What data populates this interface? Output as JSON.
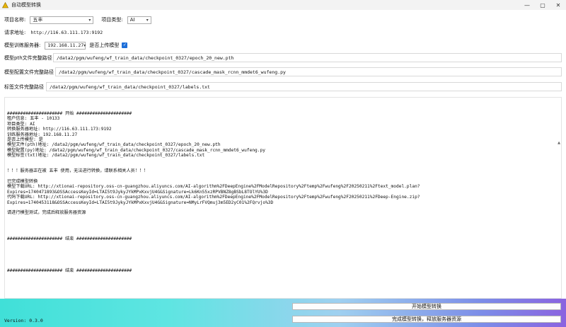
{
  "window": {
    "title": "自动模型转换",
    "minimize": "—",
    "maximize": "▢",
    "close": "✕"
  },
  "form": {
    "project_name_label": "项目名称:",
    "project_name_value": "五丰",
    "project_type_label": "项目类型:",
    "project_type_value": "AI",
    "request_url_label": "请求地址:",
    "request_url_value": "http://116.63.111.173:9192",
    "train_server_label": "模型训练服务器:",
    "train_server_value": "192.168.11.27",
    "upload_label": "是否上传模型",
    "upload_checked": true,
    "pth_label": "模型pth文件完整路径",
    "pth_value": "/data2/pgm/wufeng/wf_train_data/checkpoint_0327/epoch_20_new.pth",
    "py_label": "模型配置文件完整路径",
    "py_value": "/data2/pgm/wufeng/wf_train_data/checkpoint_0327/cascade_mask_rcnn_mmdet6_wufeng.py",
    "labels_label": "标签文件完整路径",
    "labels_value": "/data2/pgm/wufeng/wf_train_data/checkpoint_0327/labels.txt"
  },
  "log": {
    "lines": [
      "##################### 开始 #####################",
      "租户信息: 五丰 - 10133",
      "项目类型: AI",
      "转换服务器地址: http://116.63.111.173:9192",
      "训练服务器地址: 192.168.11.27",
      "是否上传模型: 是",
      "模型文件(pth)地址: /data2/pgm/wufeng/wf_train_data/checkpoint_0327/epoch_20_new.pth",
      "模型配置(py)地址: /data2/pgm/wufeng/wf_train_data/checkpoint_0327/cascade_mask_rcnn_mmdet6_wufeng.py",
      "模型标签(txt)地址: /data2/pgm/wufeng/wf_train_data/checkpoint_0327/labels.txt",
      "",
      "",
      "！！！服务器正在被 五丰 使用，无法进行转换，请联系相关人员！！！",
      "",
      "已完成模型转换",
      "模型下载URL: http://xtionai-repository.oss-cn-guangzhou.aliyuncs.com/AI-algorithm%2FDeepEngine%2FModelRepository%2Ftemp%2Fwufeng%2F20250211%2Ftext_model.plan?",
      "Expires=1740471893&OSSAccessKeyId=LTAI5t9JykyJYkMPxKxvjU4G&Signature=Lk6Kn55xzRPVBNZ8gBSbL8TOlYU%3D",
      "代码下载URL: http://xtionai-repository.oss-cn-guangzhou.aliyuncs.com/AI-algorithm%2FDeepEngine%2FModelRepository%2Ftemp%2Fwufeng%2F20250211%2FDeep-Engine.zip?",
      "Expires=1740453118&OSSAccessKeyId=LTAI5t9JykyJYkMPxKxvjU4G&Signature=NMyLrFVQmuj3m5ED2yC01%2FQrvjo%3D",
      "",
      "请进行模型测试，完成后释放服务器资源",
      "",
      "",
      "",
      "",
      "##################### 结束 #####################",
      "",
      "",
      "",
      "",
      "",
      "##################### 结束 #####################"
    ]
  },
  "footer": {
    "version": "Version: 0.3.0",
    "start_button": "开始模型转换",
    "release_button": "完成模型转换，释放服务器资源"
  },
  "colors": {
    "checkbox": "#1e6fd9",
    "gradient_start": "#40e0d8",
    "gradient_end": "#8a63e0"
  }
}
